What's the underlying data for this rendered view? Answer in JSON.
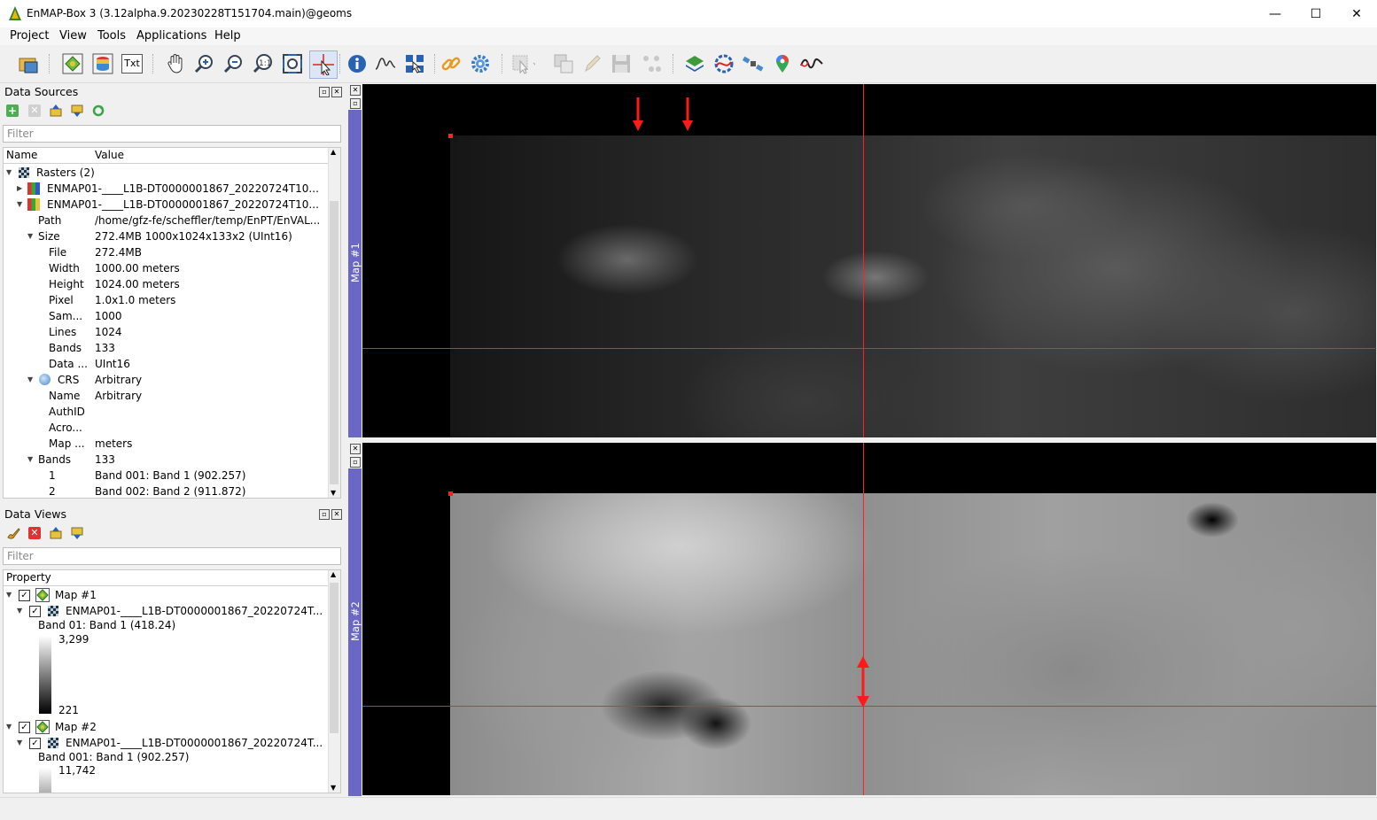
{
  "window": {
    "title": "EnMAP-Box 3 (3.12alpha.9.20230228T151704.main)@geoms",
    "minimize": "—",
    "maximize": "☐",
    "close": "✕"
  },
  "menu": [
    "Project",
    "View",
    "Tools",
    "Applications",
    "Help"
  ],
  "toolbar": {
    "txt_label": "Txt",
    "icons": [
      "open-project-icon",
      "add-data-source-icon",
      "raster-stack-icon",
      "text-view-icon",
      "pan-icon",
      "zoom-in-icon",
      "zoom-out-icon",
      "zoom-native-icon",
      "zoom-full-extent-icon",
      "select-location-icon",
      "identify-icon",
      "spectral-profile-icon",
      "cursor-location-icon",
      "link-maps-icon",
      "settings-icon",
      "select-features-icon",
      "copy-feature-icon",
      "edit-pencil-icon",
      "save-edits-icon",
      "add-feature-icon",
      "layers-icon",
      "processing-icon",
      "satellite-icon",
      "location-pin-icon",
      "spectral-library-icon"
    ]
  },
  "data_sources": {
    "title": "Data Sources",
    "filter_placeholder": "Filter",
    "col_name": "Name",
    "col_value": "Value",
    "rows": [
      {
        "k": "Rasters (2)",
        "v": ""
      },
      {
        "k": "ENMAP01-____L1B-DT0000001867_20220724T10...",
        "v": ""
      },
      {
        "k": "ENMAP01-____L1B-DT0000001867_20220724T10...",
        "v": ""
      },
      {
        "k": "Path",
        "v": "/home/gfz-fe/scheffler/temp/EnPT/EnVAL..."
      },
      {
        "k": "Size",
        "v": "272.4MB 1000x1024x133x2 (UInt16)"
      },
      {
        "k": "File",
        "v": "272.4MB"
      },
      {
        "k": "Width",
        "v": "1000.00 meters"
      },
      {
        "k": "Height",
        "v": "1024.00 meters"
      },
      {
        "k": "Pixel",
        "v": "1.0x1.0 meters"
      },
      {
        "k": "Sam...",
        "v": "1000"
      },
      {
        "k": "Lines",
        "v": "1024"
      },
      {
        "k": "Bands",
        "v": "133"
      },
      {
        "k": "Data ...",
        "v": "UInt16"
      },
      {
        "k": "CRS",
        "v": "Arbitrary"
      },
      {
        "k": "Name",
        "v": "Arbitrary"
      },
      {
        "k": "AuthID",
        "v": ""
      },
      {
        "k": "Acro...",
        "v": ""
      },
      {
        "k": "Map ...",
        "v": "meters"
      },
      {
        "k": "Bands",
        "v": "133"
      },
      {
        "k": "1",
        "v": "Band 001: Band 1 (902.257)"
      },
      {
        "k": "2",
        "v": "Band 002: Band 2 (911.872)"
      }
    ]
  },
  "data_views": {
    "title": "Data Views",
    "filter_placeholder": "Filter",
    "col_property": "Property",
    "map1": {
      "name": "Map #1",
      "layer": "ENMAP01-____L1B-DT0000001867_20220724T...",
      "band": "Band 01: Band 1 (418.24)",
      "max": "3,299",
      "min": "221"
    },
    "map2": {
      "name": "Map #2",
      "layer": "ENMAP01-____L1B-DT0000001867_20220724T...",
      "band": "Band 001: Band 1 (902.257)",
      "max": "11,742"
    }
  },
  "maps": {
    "map1_label": "Map #1",
    "map2_label": "Map #2"
  }
}
